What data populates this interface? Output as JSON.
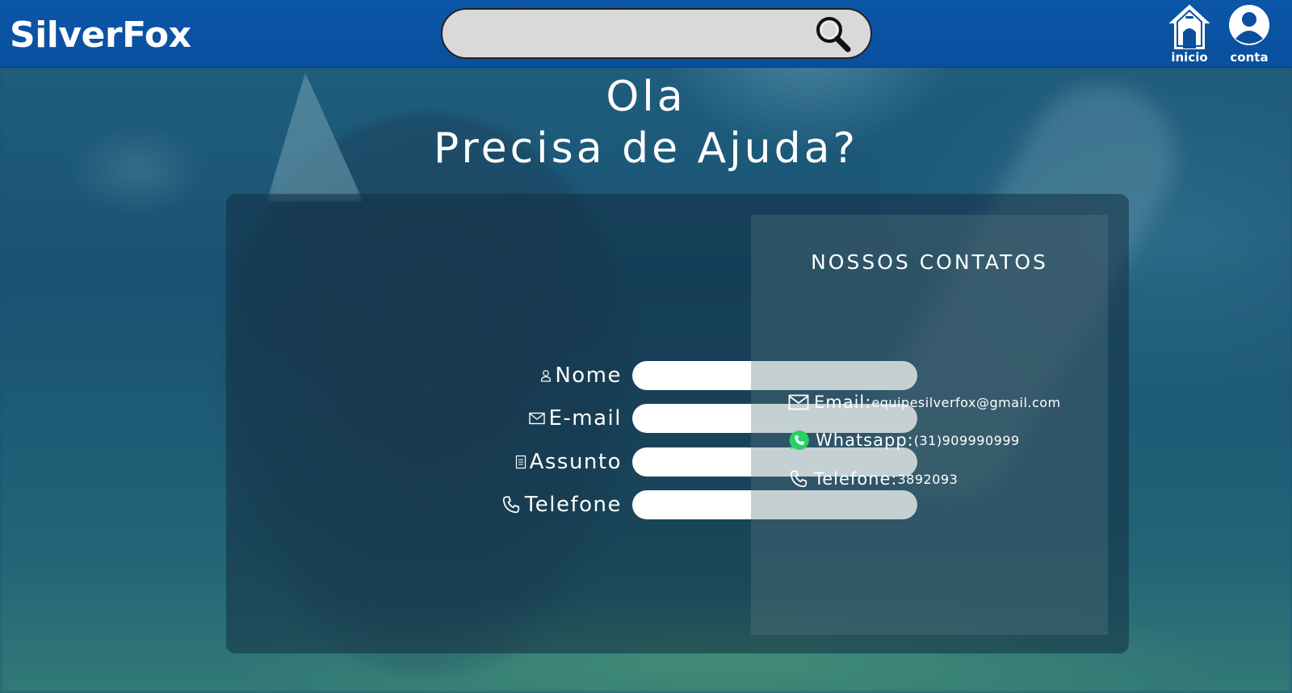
{
  "header": {
    "logo": "SilverFox",
    "search": {
      "value": "",
      "placeholder": ""
    },
    "nav": {
      "home_label": "inicio",
      "account_label": "conta"
    }
  },
  "hero": {
    "greeting": "Ola",
    "question": "Precisa de Ajuda?"
  },
  "form": {
    "name_label": "Nome",
    "email_label": "E-mail",
    "subject_label": "Assunto",
    "phone_label": "Telefone",
    "name_value": "",
    "email_value": "",
    "subject_value": "",
    "phone_value": ""
  },
  "contacts": {
    "title": "NOSSOS CONTATOS",
    "email_key": "Email:",
    "email_value": "equipesilverfox@gmail.com",
    "whatsapp_key": "Whatsapp:",
    "whatsapp_value": "(31)909990999",
    "phone_key": "Telefone:",
    "phone_value": "3892093"
  },
  "colors": {
    "header_bg": "#0a4f9e",
    "whatsapp_green": "#25d366",
    "panel_overlay": "#142d41"
  },
  "icons": [
    "search-icon",
    "home-icon",
    "account-icon",
    "user-icon",
    "mail-icon",
    "document-icon",
    "phone-icon",
    "whatsapp-icon"
  ]
}
